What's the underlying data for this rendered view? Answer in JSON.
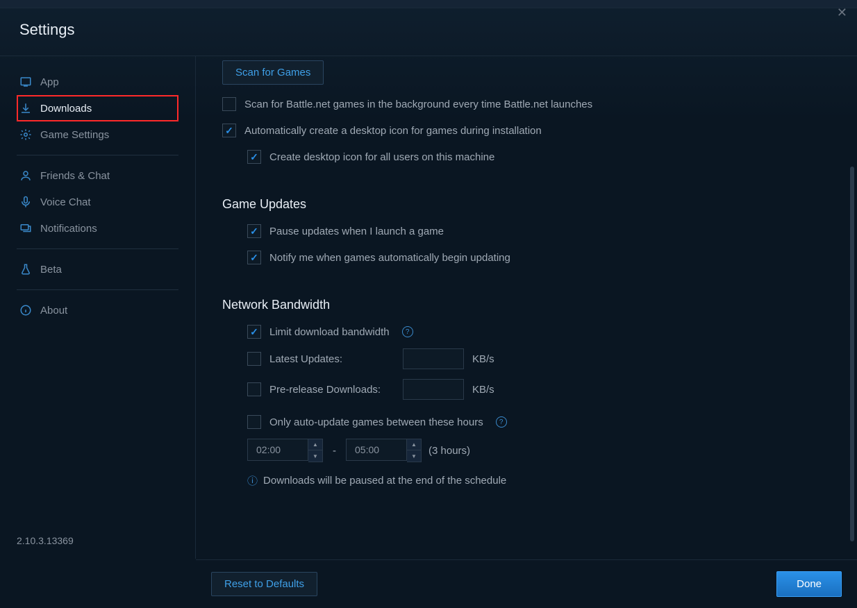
{
  "window": {
    "title": "Settings"
  },
  "sidebar": {
    "items": [
      {
        "label": "App",
        "icon": "app"
      },
      {
        "label": "Downloads",
        "icon": "download"
      },
      {
        "label": "Game Settings",
        "icon": "game-settings"
      },
      {
        "label": "Friends & Chat",
        "icon": "friends"
      },
      {
        "label": "Voice Chat",
        "icon": "voice"
      },
      {
        "label": "Notifications",
        "icon": "notifications"
      },
      {
        "label": "Beta",
        "icon": "beta"
      },
      {
        "label": "About",
        "icon": "about"
      }
    ],
    "version": "2.10.3.13369"
  },
  "content": {
    "scan_button": "Scan for Games",
    "scan_bg_label": "Scan for Battle.net games in the background every time Battle.net launches",
    "scan_bg_checked": false,
    "auto_icon_label": "Automatically create a desktop icon for games during installation",
    "auto_icon_checked": true,
    "all_users_label": "Create desktop icon for all users on this machine",
    "all_users_checked": true,
    "updates_title": "Game Updates",
    "pause_label": "Pause updates when I launch a game",
    "pause_checked": true,
    "notify_label": "Notify me when games automatically begin updating",
    "notify_checked": true,
    "bandwidth_title": "Network Bandwidth",
    "limit_label": "Limit download bandwidth",
    "limit_checked": true,
    "latest_label": "Latest Updates:",
    "latest_checked": false,
    "latest_value": "",
    "prerelease_label": "Pre-release Downloads:",
    "prerelease_checked": false,
    "prerelease_value": "",
    "unit": "KB/s",
    "only_auto_label": "Only auto-update games between these hours",
    "only_auto_checked": false,
    "time_start": "02:00",
    "time_end": "05:00",
    "time_dash": "-",
    "duration": "(3 hours)",
    "pause_info": "Downloads will be paused at the end of the schedule"
  },
  "footer": {
    "reset": "Reset to Defaults",
    "done": "Done"
  }
}
